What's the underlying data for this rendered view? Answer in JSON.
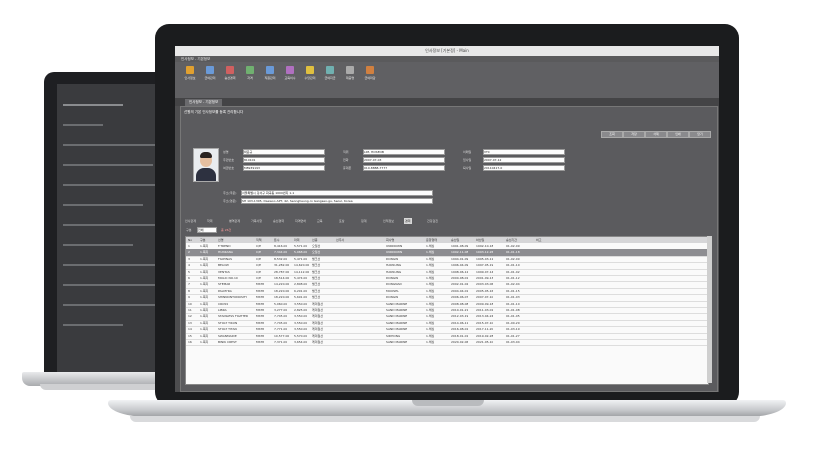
{
  "window": {
    "title": "인사정보 [기본정] - Main"
  },
  "toolbar": {
    "items": [
      {
        "label": "인사정보",
        "icon": "person-icon",
        "color": "#e0a030"
      },
      {
        "label": "급여관리",
        "icon": "doc-icon",
        "color": "#6a9ad8"
      },
      {
        "label": "승선경력",
        "icon": "ship-icon",
        "color": "#d06060"
      },
      {
        "label": "자격",
        "icon": "cert-icon",
        "color": "#70b070"
      },
      {
        "label": "직원관리",
        "icon": "id-icon",
        "color": "#6a9ad8"
      },
      {
        "label": "교육이수",
        "icon": "book-icon",
        "color": "#b070c0"
      },
      {
        "label": "수당관리",
        "icon": "coin-icon",
        "color": "#e0c040"
      },
      {
        "label": "급여지급",
        "icon": "pay-icon",
        "color": "#70b0b0"
      },
      {
        "label": "제증명",
        "icon": "print-icon",
        "color": "#aaaaaa"
      },
      {
        "label": "급여마감",
        "icon": "lock-icon",
        "color": "#d08040"
      }
    ]
  },
  "tab": {
    "label": "인사정보 - 기본정보"
  },
  "panel": {
    "title": "선원의 기본 인사정보를 등록 관리합니다",
    "fields": [
      {
        "label": "성명",
        "value": "박윤규"
      },
      {
        "label": "주민번호",
        "value": "810101"
      },
      {
        "label": "여권번호",
        "value": "M8939193"
      },
      {
        "label": "직위",
        "value": "LIM, HOSEOB"
      },
      {
        "label": "전화",
        "value": "2007-07-03"
      },
      {
        "label": "휴대폰",
        "value": "010-8888-7777"
      },
      {
        "label": "이메일",
        "value": "VTC"
      },
      {
        "label": "입사일",
        "value": "2007-07-12"
      },
      {
        "label": "퇴사일",
        "value": "20110417-0"
      }
    ],
    "address": {
      "label": "주소(국문)",
      "value": "서울특별시 강서구 화곡동 1000번지 1-1"
    },
    "address_en": {
      "label": "주소(영문)",
      "value": "SH 103-1305, Daewoo APT, 42, Seongheung-ro Gangseo-gu, Seoul, Korea"
    },
    "buttons": [
      "조회",
      "저장",
      "삭제",
      "인쇄",
      "닫기"
    ]
  },
  "inner_tabs": [
    "인사관계",
    "학력",
    "병역관계",
    "가족사항",
    "승선경력",
    "자격면허",
    "교육",
    "포상",
    "징계",
    "인적정보",
    "경력",
    "건강검진"
  ],
  "filter": {
    "label": "구분",
    "value": "전체",
    "count_label": "총 26건"
  },
  "grid": {
    "columns": [
      "No",
      "구분",
      "선명",
      "직책",
      "톤수",
      "마력",
      "선종",
      "선주사",
      "회사명",
      "운항형태",
      "승선일",
      "하선일",
      "승선기간",
      "비고"
    ],
    "rows": [
      [
        "1",
        "1.목자",
        "F.TREND",
        "C/E",
        "8,416.00",
        "5,571.00",
        "오일선",
        "UNKNOWN",
        "1.해상",
        "1991-08-09",
        "1992-10-18",
        "01-02-09"
      ],
      [
        "2",
        "1.목자",
        "HUNKANA",
        "C/E",
        "7,344.00",
        "5,968.00",
        "오일선",
        "UNKNOWN",
        "1.해상",
        "1992-11-08",
        "1993-12-26",
        "01-01-18"
      ],
      [
        "3",
        "1.목자",
        "FILIPINAS",
        "C/E",
        "8,532.00",
        "5,471.00",
        "벌크선",
        "DONGIN",
        "1.해상",
        "1994-01-09",
        "1995-03-11",
        "01-02-09"
      ],
      [
        "4",
        "1.목자",
        "BELOW",
        "C/E",
        "31,282.00",
        "14,620.00",
        "벌크선",
        "HANSUNG",
        "1.해상",
        "1996-04-09",
        "1997-05-19",
        "01-01-10"
      ],
      [
        "5",
        "1.목자",
        "VENTAS",
        "C/E",
        "28,787.00",
        "14,112.00",
        "벌크선",
        "HANSUNG",
        "1.해상",
        "1998-06-12",
        "1999-07-14",
        "01-01-02"
      ],
      [
        "6",
        "1.목자",
        "MOLIC NO.10",
        "C/E",
        "18,514.00",
        "5,474.00",
        "벌크선",
        "DONGIN",
        "1.해상",
        "2000-08-01",
        "2001-09-13",
        "01-01-12"
      ],
      [
        "7",
        "1.목자",
        "STEMAR",
        "MSTR",
        "14,220.00",
        "2,808.00",
        "벌크선",
        "DONGNAD",
        "1.해상",
        "2002-01-02",
        "2003-03-06",
        "01-02-04"
      ],
      [
        "8",
        "1.목자",
        "PALMYRA",
        "MSTR",
        "18,220.00",
        "6,291.00",
        "벌크선",
        "MOOSEL",
        "1.해상",
        "2004-04-01",
        "2005-05-16",
        "01-01-15"
      ],
      [
        "9",
        "1.목자",
        "SHINNONTONOSITY",
        "MSTR",
        "18,220.00",
        "5,691.00",
        "벌크선",
        "DONGIN",
        "1.해상",
        "2006-06-07",
        "2007-07-10",
        "01-01-03"
      ],
      [
        "10",
        "1.목자",
        "CROSS",
        "MSTR",
        "5,060.00",
        "3,550.00",
        "케미컬선",
        "SAND MARINE",
        "1.해상",
        "2008-08-08",
        "2009-09-18",
        "01-01-10"
      ],
      [
        "11",
        "1.목자",
        "LIBRA",
        "MSTR",
        "3,277.00",
        "2,825.00",
        "케미컬선",
        "SAND MARINE",
        "1.해상",
        "2010-01-21",
        "2011-03-01",
        "01-01-08"
      ],
      [
        "12",
        "1.목자",
        "STAINLESS FIGHTER",
        "MSTR",
        "7,745.00",
        "3,550.00",
        "케미컬선",
        "SAND MARINE",
        "1.해상",
        "2012-03-19",
        "2013-04-24",
        "01-01-05"
      ],
      [
        "13",
        "1.목자",
        "STOLT TIKUN",
        "MSTR",
        "7,745.00",
        "3,550.00",
        "케미컬선",
        "SAND MARINE",
        "1.해상",
        "2014-06-11",
        "2015-07-10",
        "01-00-29"
      ],
      [
        "14",
        "1.목자",
        "STOLT TITAN",
        "MSTR",
        "7,771.00",
        "3,550.00",
        "케미컬선",
        "SAND MARINE",
        "1.해상",
        "2016-08-01",
        "2017-11-20",
        "01-03-19"
      ],
      [
        "15",
        "1.목자",
        "SWANMAIDE",
        "MSTR",
        "10,577.00",
        "5,570.00",
        "케미컬선",
        "SIDHONG",
        "1.해상",
        "2018-01-01",
        "2019-02-28",
        "01-01-27"
      ],
      [
        "16",
        "1.목자",
        "BINIK CREST",
        "MSTR",
        "7,371.00",
        "3,654.00",
        "케미컬선",
        "SAND MARINE",
        "1.해상",
        "2020-02-06",
        "2021-05-10",
        "01-03-04"
      ]
    ]
  }
}
